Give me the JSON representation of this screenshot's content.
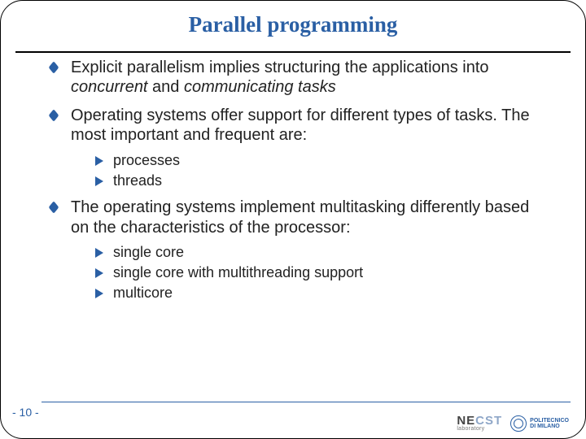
{
  "title": "Parallel programming",
  "bullets": [
    {
      "html": "Explicit parallelism implies structuring the applications into <em>concurrent</em> and <em>communicating tasks</em>"
    },
    {
      "html": "Operating systems offer support for different types of tasks. The most important and frequent are:",
      "sub": [
        "processes",
        "threads"
      ]
    },
    {
      "html": "The operating systems implement multitasking differently based on the characteristics of the processor:",
      "sub": [
        "single core",
        "single core with multithreading support",
        "multicore"
      ]
    }
  ],
  "page_number": "- 10 -",
  "logos": {
    "necst_main_a": "NE",
    "necst_main_b": "CST",
    "necst_sub": "laboratory",
    "polimi_line1": "POLITECNICO",
    "polimi_line2": "DI MILANO"
  }
}
